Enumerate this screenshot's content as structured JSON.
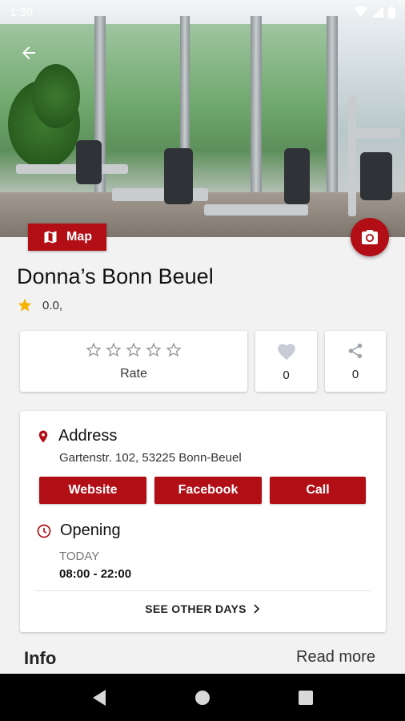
{
  "status_bar": {
    "time": "1:39"
  },
  "hero": {
    "map_label": "Map"
  },
  "place": {
    "name": "Donna’s Bonn Beuel",
    "rating": "0.0,"
  },
  "actions": {
    "rate_label": "Rate",
    "favorites_count": "0",
    "shares_count": "0"
  },
  "address": {
    "heading": "Address",
    "text": "Gartenstr. 102, 53225  Bonn-Beuel",
    "buttons": [
      "Website",
      "Facebook",
      "Call"
    ]
  },
  "opening": {
    "heading": "Opening",
    "day_label": "TODAY",
    "hours": "08:00 - 22:00",
    "see_other_days": "SEE OTHER DAYS"
  },
  "info": {
    "heading": "Info",
    "read_more": "Read more"
  },
  "colors": {
    "accent": "#b20e16",
    "star": "#f5b400"
  }
}
